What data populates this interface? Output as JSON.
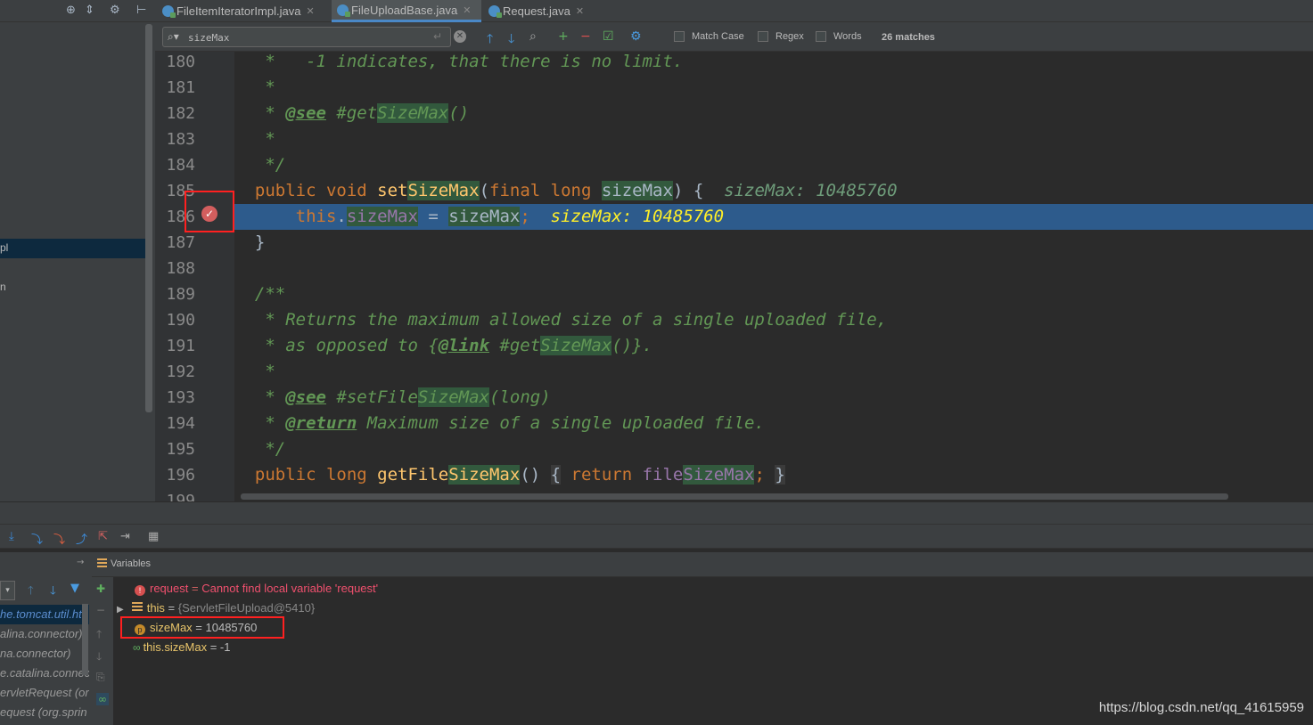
{
  "tabs": [
    {
      "label": "FileItemIteratorImpl.java",
      "active": false
    },
    {
      "label": "FileUploadBase.java",
      "active": true
    },
    {
      "label": "Request.java",
      "active": false
    }
  ],
  "left_panel": {
    "items": [
      "pl",
      "n"
    ]
  },
  "search": {
    "query": "sizeMax",
    "options": [
      "Match Case",
      "Regex",
      "Words"
    ],
    "matches": "26 matches"
  },
  "editor": {
    "line_numbers": [
      "180",
      "181",
      "182",
      "183",
      "184",
      "185",
      "186",
      "187",
      "188",
      "189",
      "190",
      "191",
      "192",
      "193",
      "194",
      "195",
      "196",
      "199"
    ],
    "inlay_setSizeMax": "sizeMax: 10485760",
    "inlay_exec": "sizeMax: 10485760"
  },
  "debug": {
    "variables_title": "Variables",
    "frames": [
      "he.tomcat.util.ht",
      "alina.connector)",
      "na.connector)",
      "e.catalina.connec",
      "ervletRequest (or",
      "equest (org.sprin"
    ],
    "variables": [
      {
        "name": "request",
        "eq": " = ",
        "value": "Cannot find local variable 'request'",
        "kind": "error"
      },
      {
        "name": "this",
        "eq": " = ",
        "value": "{ServletFileUpload@5410}",
        "kind": "object"
      },
      {
        "name": "sizeMax",
        "eq": " = ",
        "value": "10485760",
        "kind": "param"
      },
      {
        "name": "this.sizeMax",
        "eq": " = ",
        "value": "-1",
        "kind": "watch"
      }
    ]
  },
  "watermark": "https://blog.csdn.net/qq_41615959",
  "colors": {
    "accent": "#4a88c7",
    "exec_line": "#2d5b8c",
    "breakpoint": "#d35e5e",
    "highlight_box": "#ff2020"
  }
}
